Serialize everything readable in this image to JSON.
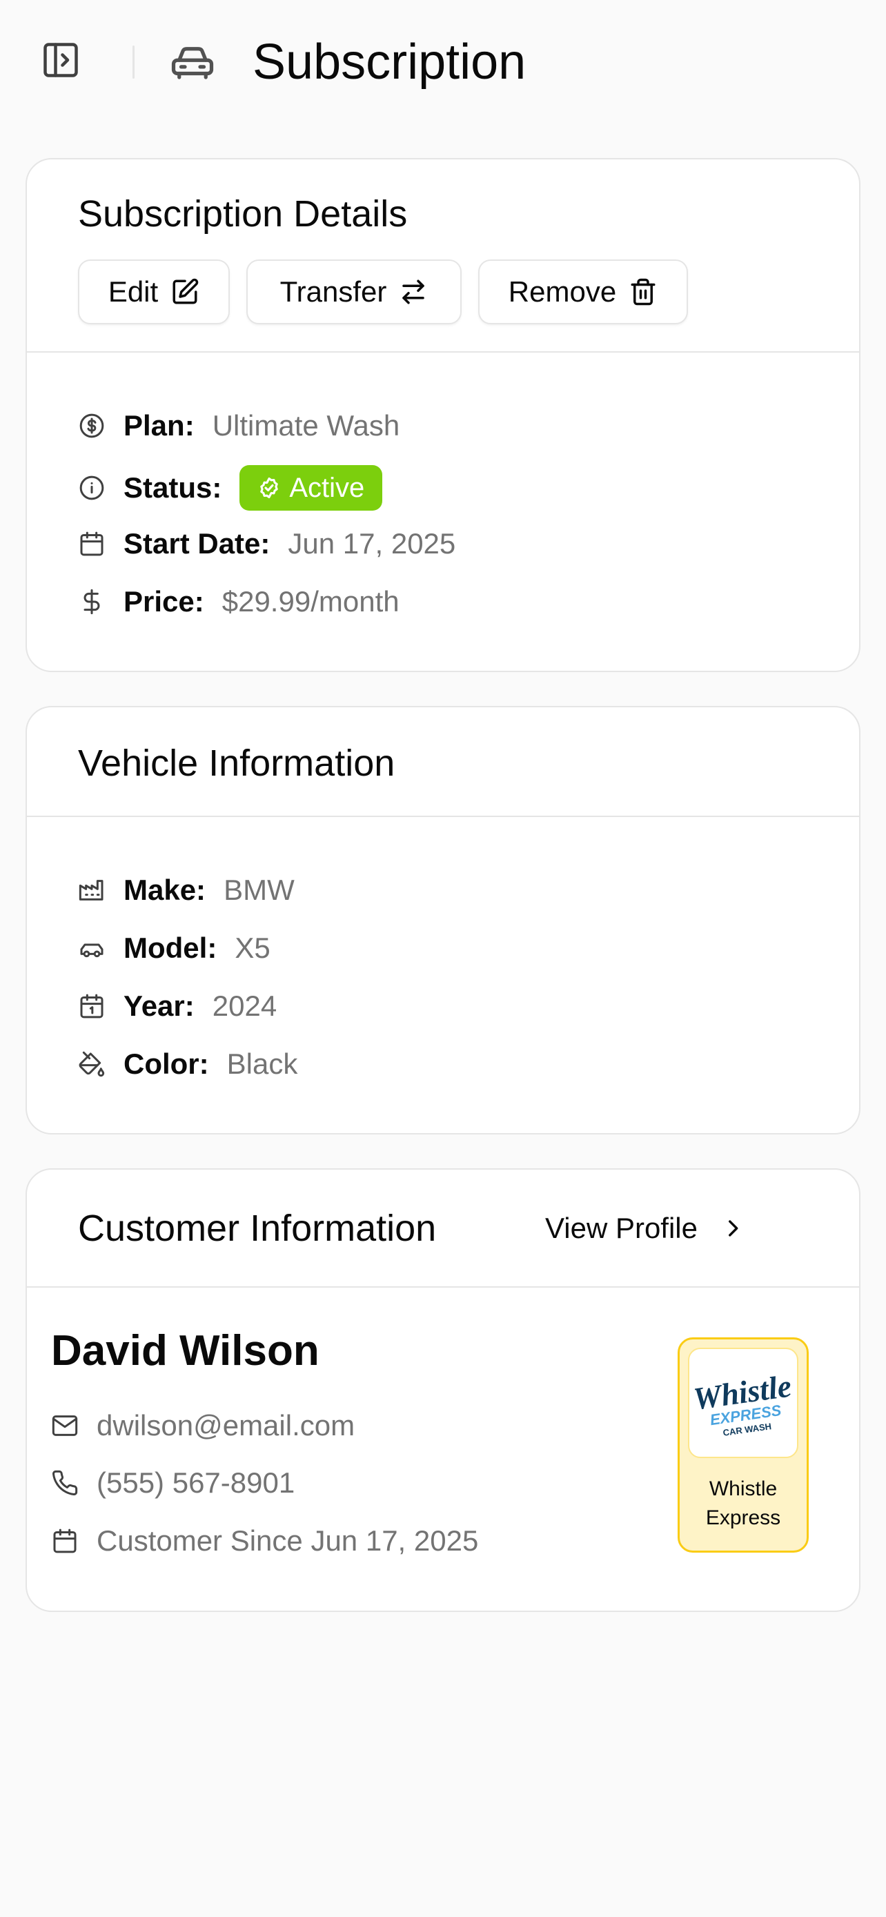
{
  "header": {
    "title": "Subscription",
    "sidebar_toggle_icon": "sidebar-toggle-icon",
    "page_icon": "car-icon"
  },
  "subscription": {
    "title": "Subscription Details",
    "buttons": {
      "edit": "Edit",
      "transfer": "Transfer",
      "remove": "Remove"
    },
    "plan_label": "Plan:",
    "plan_value": "Ultimate Wash",
    "status_label": "Status:",
    "status_value": "Active",
    "start_label": "Start Date:",
    "start_value": "Jun 17, 2025",
    "price_label": "Price:",
    "price_value": "$29.99/month"
  },
  "vehicle": {
    "title": "Vehicle Information",
    "make_label": "Make:",
    "make_value": "BMW",
    "model_label": "Model:",
    "model_value": "X5",
    "year_label": "Year:",
    "year_value": "2024",
    "color_label": "Color:",
    "color_value": "Black"
  },
  "customer": {
    "title": "Customer Information",
    "view_profile": "View Profile",
    "name": "David Wilson",
    "email": "dwilson@email.com",
    "phone": "(555) 567-8901",
    "since": "Customer Since Jun 17, 2025",
    "brand_name": "Whistle Express",
    "brand_logo_text": "Whistle",
    "brand_logo_sub": "EXPRESS",
    "brand_logo_tag": "CAR WASH"
  },
  "colors": {
    "accent_green": "#7ccf0d",
    "muted_text": "#737373",
    "brand_bg": "#fef3c7",
    "brand_border": "#facc15"
  }
}
